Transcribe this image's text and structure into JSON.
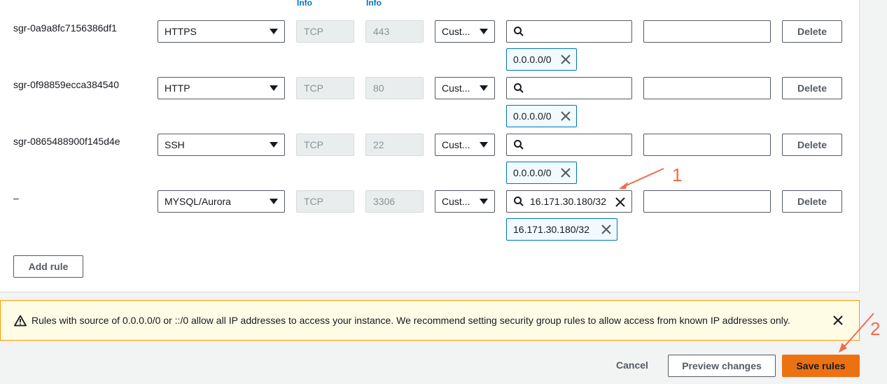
{
  "header": {
    "protocol_info": "Info",
    "port_info": "Info"
  },
  "rules": [
    {
      "id": "sgr-0a9a8fc7156386df1",
      "type": "HTTPS",
      "protocol": "TCP",
      "port": "443",
      "source_type": "Cust...",
      "search_value": "",
      "token": "0.0.0.0/0",
      "delete_label": "Delete"
    },
    {
      "id": "sgr-0f98859ecca384540",
      "type": "HTTP",
      "protocol": "TCP",
      "port": "80",
      "source_type": "Cust...",
      "search_value": "",
      "token": "0.0.0.0/0",
      "delete_label": "Delete"
    },
    {
      "id": "sgr-0865488900f145d4e",
      "type": "SSH",
      "protocol": "TCP",
      "port": "22",
      "source_type": "Cust...",
      "search_value": "",
      "token": "0.0.0.0/0",
      "delete_label": "Delete"
    },
    {
      "id": "–",
      "type": "MYSQL/Aurora",
      "protocol": "TCP",
      "port": "3306",
      "source_type": "Cust...",
      "search_value": "16.171.30.180/32",
      "token": "16.171.30.180/32",
      "delete_label": "Delete"
    }
  ],
  "add_rule_label": "Add rule",
  "warning": {
    "text": "Rules with source of 0.0.0.0/0 or ::/0 allow all IP addresses to access your instance. We recommend setting security group rules to allow access from known IP addresses only."
  },
  "footer": {
    "cancel_label": "Cancel",
    "preview_label": "Preview changes",
    "save_label": "Save rules"
  },
  "annotations": {
    "marker_1": "1",
    "marker_2": "2",
    "color": "#f26b4a"
  },
  "colors": {
    "primary": "#ec7211",
    "link": "#0073bb",
    "warning_border": "#ff9900"
  }
}
